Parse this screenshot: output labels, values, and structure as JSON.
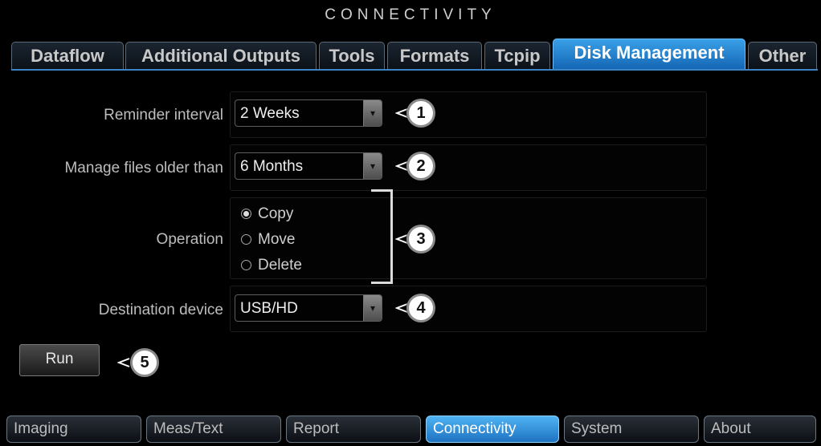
{
  "window": {
    "title": "CONNECTIVITY"
  },
  "tabs": [
    {
      "label": "Dataflow"
    },
    {
      "label": "Additional Outputs"
    },
    {
      "label": "Tools"
    },
    {
      "label": "Formats"
    },
    {
      "label": "Tcpip"
    },
    {
      "label": "Disk Management",
      "active": true
    },
    {
      "label": "Other"
    }
  ],
  "settings": {
    "reminder": {
      "label": "Reminder interval",
      "value": "2 Weeks"
    },
    "manage": {
      "label": "Manage files older than",
      "value": "6 Months"
    },
    "operation": {
      "label": "Operation",
      "options": [
        {
          "label": "Copy",
          "selected": true
        },
        {
          "label": "Move",
          "selected": false
        },
        {
          "label": "Delete",
          "selected": false
        }
      ]
    },
    "destination": {
      "label": "Destination device",
      "value": "USB/HD"
    }
  },
  "run": {
    "label": "Run"
  },
  "callouts": [
    "1",
    "2",
    "3",
    "4",
    "5"
  ],
  "bottom_tabs": [
    {
      "label": "Imaging"
    },
    {
      "label": "Meas/Text"
    },
    {
      "label": "Report"
    },
    {
      "label": "Connectivity",
      "active": true
    },
    {
      "label": "System"
    },
    {
      "label": "About"
    }
  ],
  "colors": {
    "accent": "#1f72c1",
    "background": "#000000"
  }
}
